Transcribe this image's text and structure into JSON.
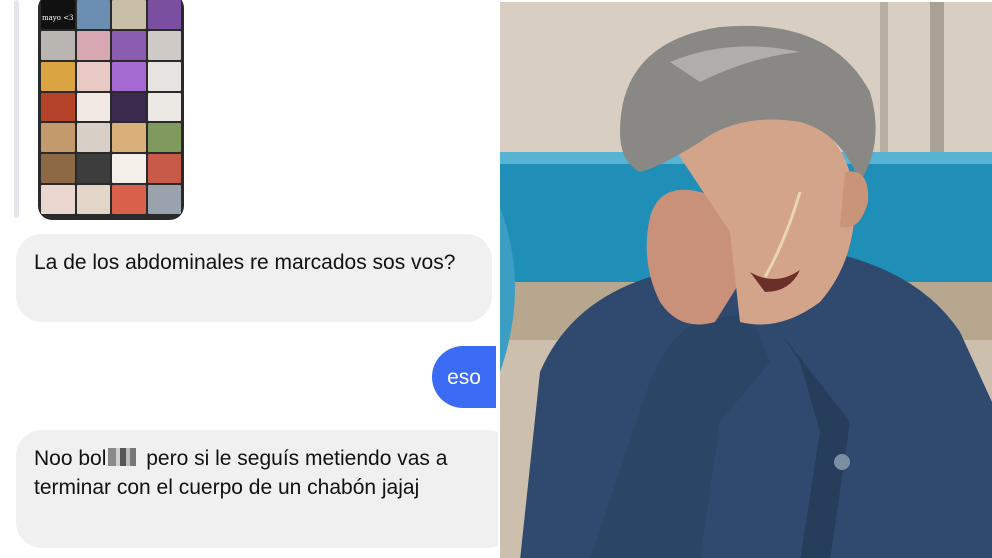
{
  "shared_post": {
    "caption": "mayo <3"
  },
  "messages": [
    {
      "direction": "incoming",
      "text": "La de los abdominales re marcados sos vos?"
    },
    {
      "direction": "outgoing",
      "text": "eso"
    },
    {
      "direction": "incoming",
      "text_before": "Noo bol",
      "text_after": "pero si le seguís metiendo vas a terminar con el cuerpo de un chabón jajaj"
    }
  ],
  "colors": {
    "outgoing_bubble": "#3b6bf5",
    "incoming_bubble": "#f0f0f0",
    "background": "#ffffff"
  },
  "photo": {
    "icon": "crying-man-photo"
  }
}
